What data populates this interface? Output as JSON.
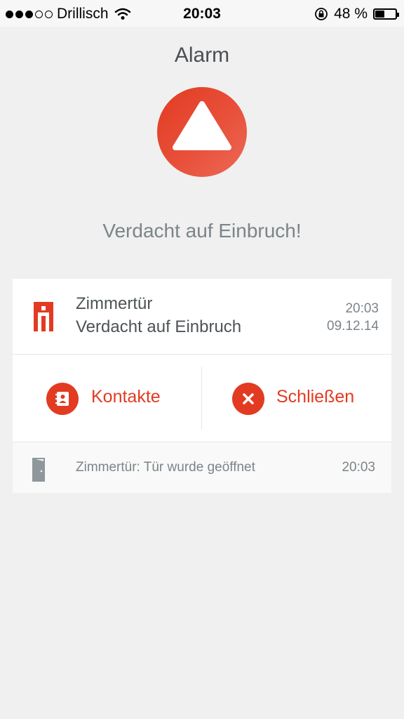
{
  "status_bar": {
    "carrier": "Drillisch",
    "time": "20:03",
    "battery_text": "48 %",
    "battery_level": 0.48,
    "signal_bars_filled": 3,
    "signal_bars_total": 5,
    "icons": [
      "signal-dots-icon",
      "wifi-icon",
      "rotation-lock-icon",
      "battery-icon"
    ]
  },
  "header": {
    "title": "Alarm",
    "alarm_icon": "warning-triangle-icon",
    "message": "Verdacht auf Einbruch!"
  },
  "event": {
    "icon": "door-sensor-icon",
    "name": "Zimmertür",
    "description": "Verdacht auf Einbruch",
    "time": "20:03",
    "date": "09.12.14"
  },
  "actions": {
    "contacts_label": "Kontakte",
    "contacts_icon": "address-book-icon",
    "close_label": "Schließen",
    "close_icon": "close-icon"
  },
  "log": {
    "icon": "open-door-icon",
    "text": "Zimmertür: Tür wurde geöffnet",
    "time": "20:03"
  },
  "colors": {
    "accent": "#e23b22",
    "background": "#eff0ef",
    "text_dark": "#4d5356",
    "text_muted": "#7c8489"
  }
}
